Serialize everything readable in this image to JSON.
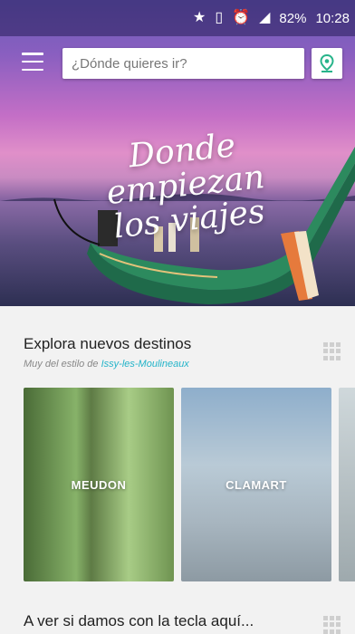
{
  "status": {
    "battery": "82%",
    "time": "10:28"
  },
  "search": {
    "placeholder": "¿Dónde quieres ir?"
  },
  "hero": {
    "title_line1": "Donde empiezan",
    "title_line2": "los viajes"
  },
  "section1": {
    "title": "Explora nuevos destinos",
    "subtitle_prefix": "Muy del estilo de ",
    "subtitle_place": "Issy-les-Moulineaux",
    "cards": [
      {
        "label": "MEUDON"
      },
      {
        "label": "CLAMART"
      }
    ]
  },
  "section2": {
    "title": "A ver si damos con la tecla aquí..."
  }
}
